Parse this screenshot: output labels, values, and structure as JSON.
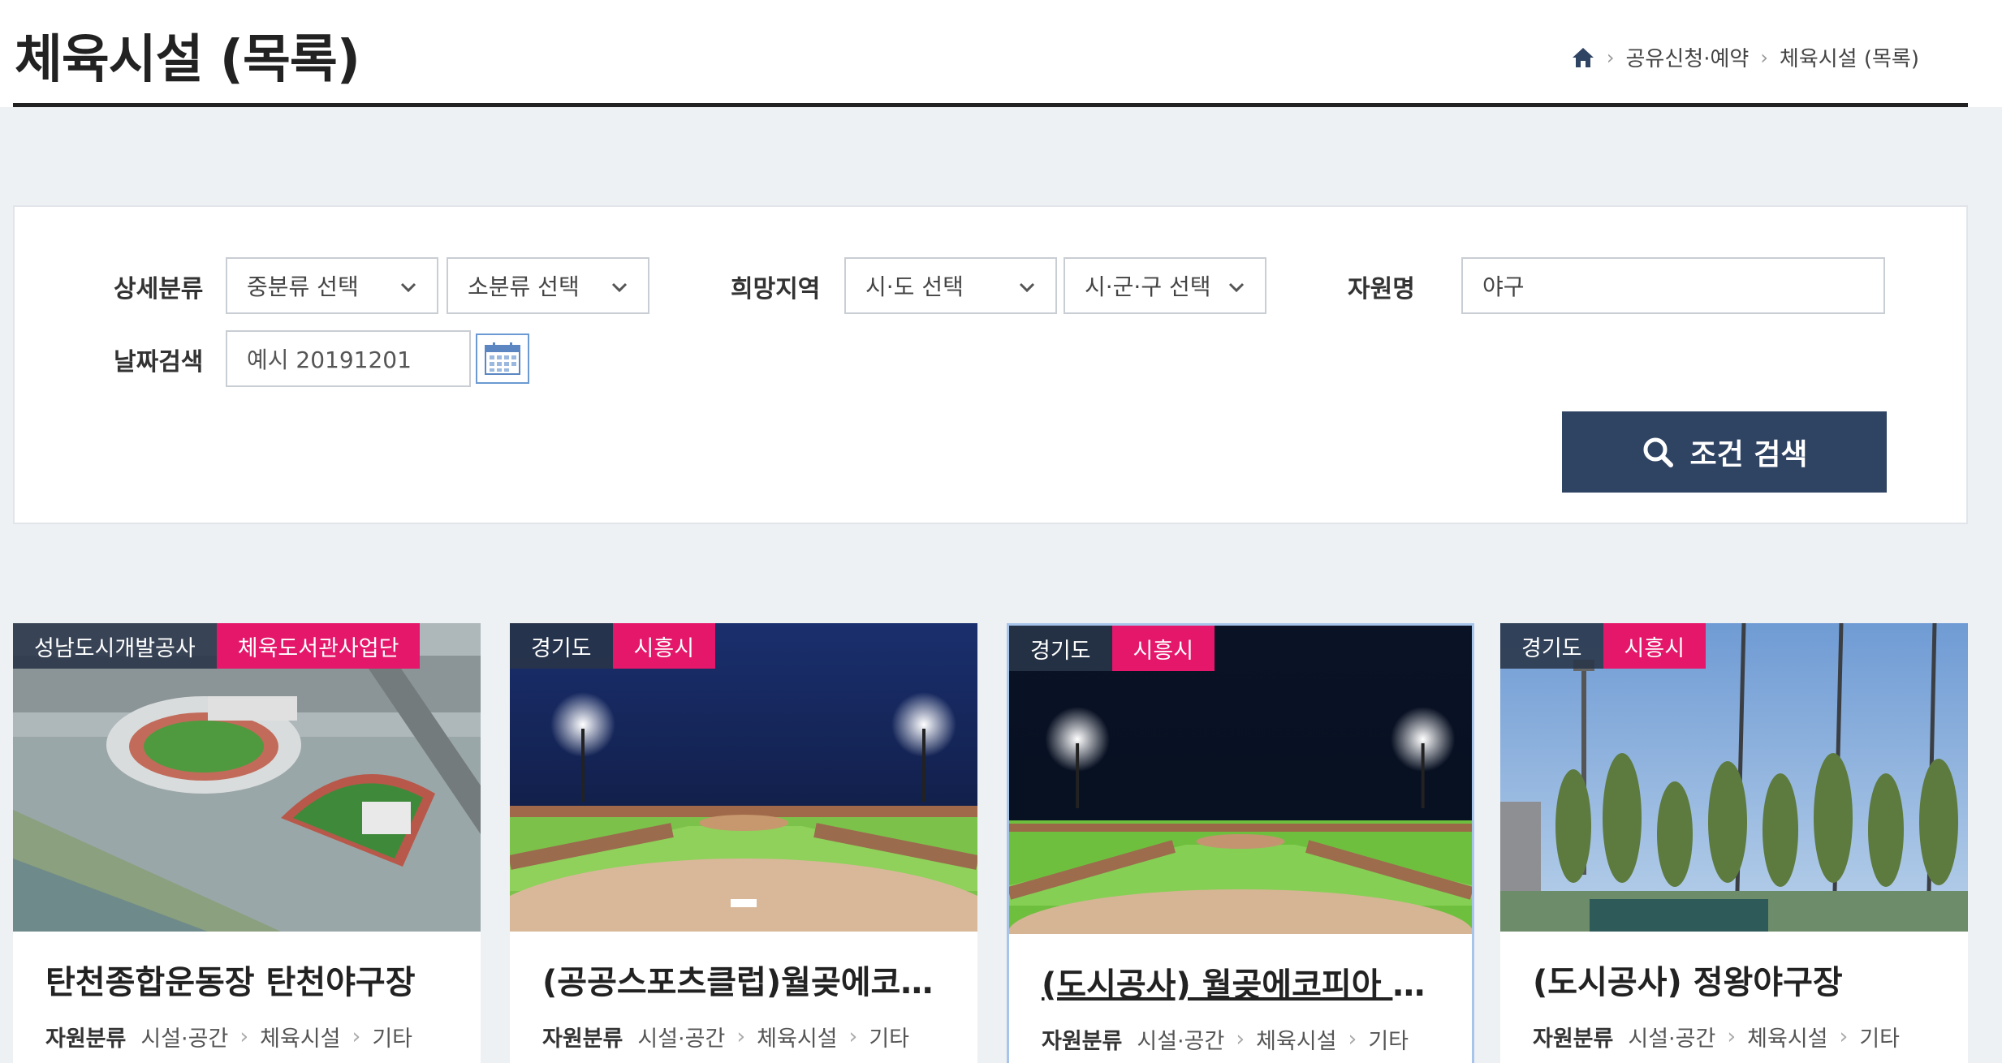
{
  "header": {
    "title": "체육시설 (목록)",
    "breadcrumb": [
      "공유신청·예약",
      "체육시설 (목록)"
    ]
  },
  "search": {
    "detail_label": "상세분류",
    "mid_category": "중분류 선택",
    "sub_category": "소분류 선택",
    "region_label": "희망지역",
    "province": "시·도 선택",
    "district": "시·군·구 선택",
    "resource_label": "자원명",
    "resource_value": "야구",
    "date_label": "날짜검색",
    "date_placeholder": "예시 20191201",
    "button_label": "조건 검색"
  },
  "cards": [
    {
      "org": "성남도시개발공사",
      "region": "체육도서관사업단",
      "title": "탄천종합운동장 탄천야구장",
      "meta_label": "자원분류",
      "path": [
        "시설·공간",
        "체육시설",
        "기타"
      ]
    },
    {
      "org": "경기도",
      "region": "시흥시",
      "title": "(공공스포츠클럽)월곶에코…",
      "meta_label": "자원분류",
      "path": [
        "시설·공간",
        "체육시설",
        "기타"
      ]
    },
    {
      "org": "경기도",
      "region": "시흥시",
      "title": "(도시공사) 월곶에코피아 야…",
      "meta_label": "자원분류",
      "path": [
        "시설·공간",
        "체육시설",
        "기타"
      ]
    },
    {
      "org": "경기도",
      "region": "시흥시",
      "title": "(도시공사) 정왕야구장",
      "meta_label": "자원분류",
      "path": [
        "시설·공간",
        "체육시설",
        "기타"
      ]
    }
  ],
  "colors": {
    "accent_pink": "#e4176a",
    "button_navy": "#2f4363",
    "page_bg": "#eef1f4"
  }
}
